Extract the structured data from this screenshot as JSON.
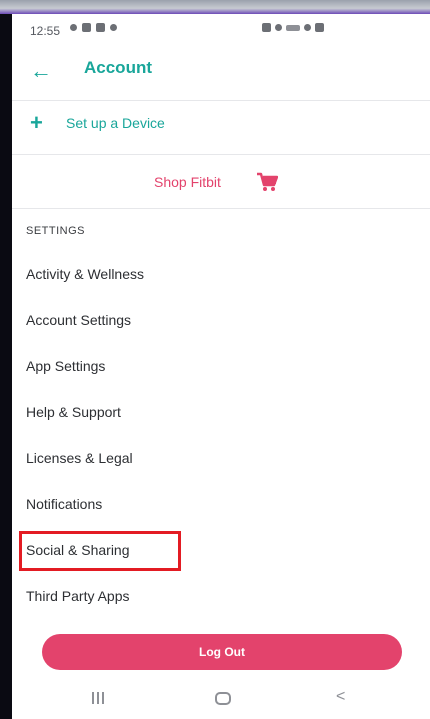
{
  "status_bar": {
    "time": "12:55",
    "left_icons": [
      "location-icon",
      "p-icon",
      "gallery-icon",
      "temperature-icon"
    ],
    "right_icons": [
      "nfc-icon",
      "mute-icon",
      "signal-icon",
      "wifi-icon",
      "battery-icon"
    ]
  },
  "app_bar": {
    "title": "Account",
    "back_icon": "arrow-left-icon"
  },
  "setup": {
    "label": "Set up a Device",
    "icon": "plus-icon"
  },
  "shop": {
    "label": "Shop Fitbit",
    "icon": "cart-icon"
  },
  "settings": {
    "header": "SETTINGS",
    "items": [
      {
        "label": "Activity & Wellness"
      },
      {
        "label": "Account Settings"
      },
      {
        "label": "App Settings"
      },
      {
        "label": "Help & Support"
      },
      {
        "label": "Licenses & Legal"
      },
      {
        "label": "Notifications"
      },
      {
        "label": "Social & Sharing"
      },
      {
        "label": "Third Party Apps"
      }
    ]
  },
  "logout": {
    "label": "Log Out"
  },
  "colors": {
    "accent": "#19a69a",
    "brand_pink": "#e3436c",
    "highlight_border": "#e31b23"
  },
  "nav": {
    "icons": [
      "recent-apps-icon",
      "home-icon",
      "back-icon"
    ]
  }
}
